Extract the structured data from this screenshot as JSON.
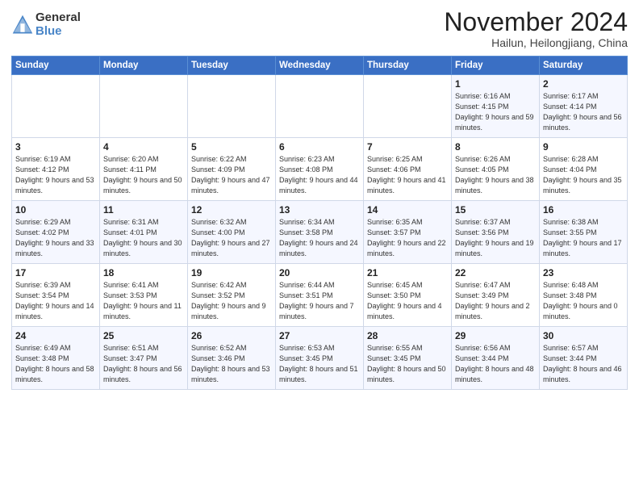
{
  "header": {
    "logo_general": "General",
    "logo_blue": "Blue",
    "month_title": "November 2024",
    "location": "Hailun, Heilongjiang, China"
  },
  "days_of_week": [
    "Sunday",
    "Monday",
    "Tuesday",
    "Wednesday",
    "Thursday",
    "Friday",
    "Saturday"
  ],
  "weeks": [
    [
      {
        "day": "",
        "info": ""
      },
      {
        "day": "",
        "info": ""
      },
      {
        "day": "",
        "info": ""
      },
      {
        "day": "",
        "info": ""
      },
      {
        "day": "",
        "info": ""
      },
      {
        "day": "1",
        "info": "Sunrise: 6:16 AM\nSunset: 4:15 PM\nDaylight: 9 hours and 59 minutes."
      },
      {
        "day": "2",
        "info": "Sunrise: 6:17 AM\nSunset: 4:14 PM\nDaylight: 9 hours and 56 minutes."
      }
    ],
    [
      {
        "day": "3",
        "info": "Sunrise: 6:19 AM\nSunset: 4:12 PM\nDaylight: 9 hours and 53 minutes."
      },
      {
        "day": "4",
        "info": "Sunrise: 6:20 AM\nSunset: 4:11 PM\nDaylight: 9 hours and 50 minutes."
      },
      {
        "day": "5",
        "info": "Sunrise: 6:22 AM\nSunset: 4:09 PM\nDaylight: 9 hours and 47 minutes."
      },
      {
        "day": "6",
        "info": "Sunrise: 6:23 AM\nSunset: 4:08 PM\nDaylight: 9 hours and 44 minutes."
      },
      {
        "day": "7",
        "info": "Sunrise: 6:25 AM\nSunset: 4:06 PM\nDaylight: 9 hours and 41 minutes."
      },
      {
        "day": "8",
        "info": "Sunrise: 6:26 AM\nSunset: 4:05 PM\nDaylight: 9 hours and 38 minutes."
      },
      {
        "day": "9",
        "info": "Sunrise: 6:28 AM\nSunset: 4:04 PM\nDaylight: 9 hours and 35 minutes."
      }
    ],
    [
      {
        "day": "10",
        "info": "Sunrise: 6:29 AM\nSunset: 4:02 PM\nDaylight: 9 hours and 33 minutes."
      },
      {
        "day": "11",
        "info": "Sunrise: 6:31 AM\nSunset: 4:01 PM\nDaylight: 9 hours and 30 minutes."
      },
      {
        "day": "12",
        "info": "Sunrise: 6:32 AM\nSunset: 4:00 PM\nDaylight: 9 hours and 27 minutes."
      },
      {
        "day": "13",
        "info": "Sunrise: 6:34 AM\nSunset: 3:58 PM\nDaylight: 9 hours and 24 minutes."
      },
      {
        "day": "14",
        "info": "Sunrise: 6:35 AM\nSunset: 3:57 PM\nDaylight: 9 hours and 22 minutes."
      },
      {
        "day": "15",
        "info": "Sunrise: 6:37 AM\nSunset: 3:56 PM\nDaylight: 9 hours and 19 minutes."
      },
      {
        "day": "16",
        "info": "Sunrise: 6:38 AM\nSunset: 3:55 PM\nDaylight: 9 hours and 17 minutes."
      }
    ],
    [
      {
        "day": "17",
        "info": "Sunrise: 6:39 AM\nSunset: 3:54 PM\nDaylight: 9 hours and 14 minutes."
      },
      {
        "day": "18",
        "info": "Sunrise: 6:41 AM\nSunset: 3:53 PM\nDaylight: 9 hours and 11 minutes."
      },
      {
        "day": "19",
        "info": "Sunrise: 6:42 AM\nSunset: 3:52 PM\nDaylight: 9 hours and 9 minutes."
      },
      {
        "day": "20",
        "info": "Sunrise: 6:44 AM\nSunset: 3:51 PM\nDaylight: 9 hours and 7 minutes."
      },
      {
        "day": "21",
        "info": "Sunrise: 6:45 AM\nSunset: 3:50 PM\nDaylight: 9 hours and 4 minutes."
      },
      {
        "day": "22",
        "info": "Sunrise: 6:47 AM\nSunset: 3:49 PM\nDaylight: 9 hours and 2 minutes."
      },
      {
        "day": "23",
        "info": "Sunrise: 6:48 AM\nSunset: 3:48 PM\nDaylight: 9 hours and 0 minutes."
      }
    ],
    [
      {
        "day": "24",
        "info": "Sunrise: 6:49 AM\nSunset: 3:48 PM\nDaylight: 8 hours and 58 minutes."
      },
      {
        "day": "25",
        "info": "Sunrise: 6:51 AM\nSunset: 3:47 PM\nDaylight: 8 hours and 56 minutes."
      },
      {
        "day": "26",
        "info": "Sunrise: 6:52 AM\nSunset: 3:46 PM\nDaylight: 8 hours and 53 minutes."
      },
      {
        "day": "27",
        "info": "Sunrise: 6:53 AM\nSunset: 3:45 PM\nDaylight: 8 hours and 51 minutes."
      },
      {
        "day": "28",
        "info": "Sunrise: 6:55 AM\nSunset: 3:45 PM\nDaylight: 8 hours and 50 minutes."
      },
      {
        "day": "29",
        "info": "Sunrise: 6:56 AM\nSunset: 3:44 PM\nDaylight: 8 hours and 48 minutes."
      },
      {
        "day": "30",
        "info": "Sunrise: 6:57 AM\nSunset: 3:44 PM\nDaylight: 8 hours and 46 minutes."
      }
    ]
  ]
}
